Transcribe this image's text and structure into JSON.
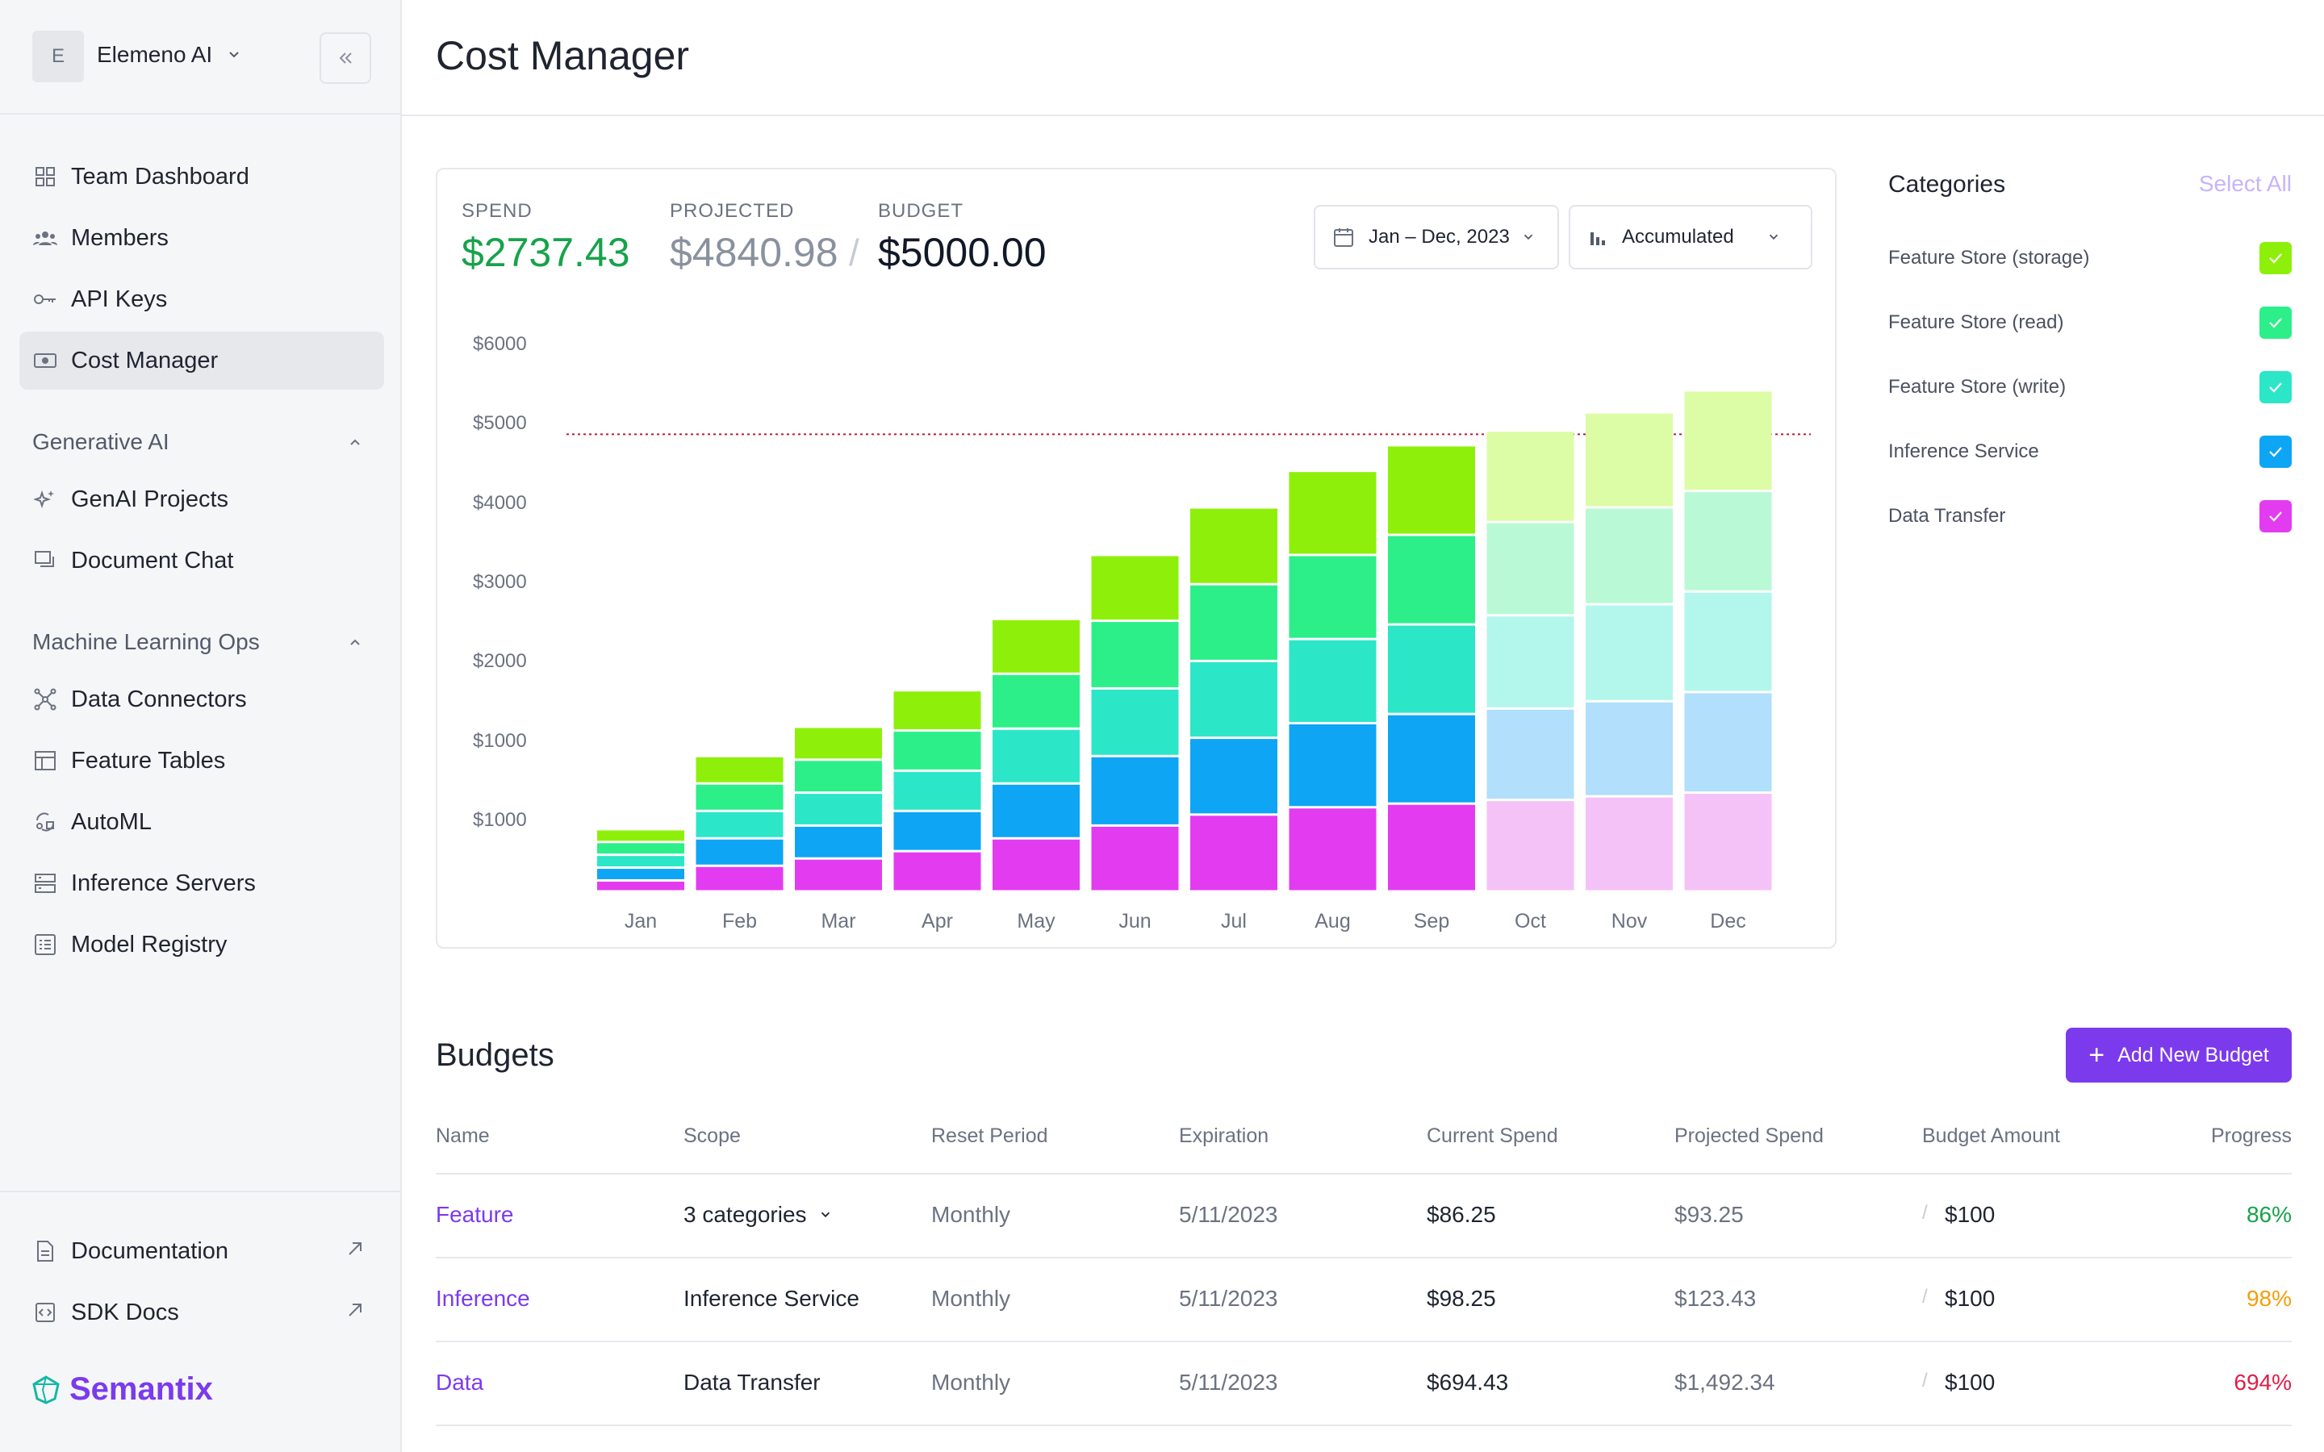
{
  "org": {
    "avatar_letter": "E",
    "name": "Elemeno AI"
  },
  "sidebar": {
    "items": [
      {
        "label": "Team Dashboard",
        "icon": "grid-icon"
      },
      {
        "label": "Members",
        "icon": "users-icon"
      },
      {
        "label": "API Keys",
        "icon": "key-icon"
      },
      {
        "label": "Cost Manager",
        "icon": "cash-icon",
        "active": true
      }
    ],
    "sections": [
      {
        "label": "Generative AI",
        "items": [
          {
            "label": "GenAI Projects",
            "icon": "sparkles-icon"
          },
          {
            "label": "Document Chat",
            "icon": "chat-icon"
          }
        ]
      },
      {
        "label": "Machine Learning Ops",
        "items": [
          {
            "label": "Data Connectors",
            "icon": "hub-icon"
          },
          {
            "label": "Feature Tables",
            "icon": "table-icon"
          },
          {
            "label": "AutoML",
            "icon": "automl-icon"
          },
          {
            "label": "Inference Servers",
            "icon": "server-icon"
          },
          {
            "label": "Model Registry",
            "icon": "registry-icon"
          }
        ]
      }
    ],
    "footer": [
      {
        "label": "Documentation",
        "icon": "document-icon"
      },
      {
        "label": "SDK Docs",
        "icon": "code-icon"
      }
    ],
    "brand": "Semantix"
  },
  "page": {
    "title": "Cost Manager"
  },
  "metrics": {
    "spend_label": "SPEND",
    "spend_value": "$2737.43",
    "projected_label": "PROJECTED",
    "projected_value": "$4840.98",
    "slash": "/",
    "budget_label": "BUDGET",
    "budget_value": "$5000.00"
  },
  "controls": {
    "date_range": "Jan – Dec, 2023",
    "mode": "Accumulated"
  },
  "categories": {
    "title": "Categories",
    "select_all": "Select All",
    "items": [
      {
        "label": "Feature Store (storage)",
        "color": "#8ef00a",
        "checked": true
      },
      {
        "label": "Feature Store (read)",
        "color": "#2cef8a",
        "checked": true
      },
      {
        "label": "Feature Store (write)",
        "color": "#2ce6c8",
        "checked": true
      },
      {
        "label": "Inference Service",
        "color": "#0ea5f5",
        "checked": true
      },
      {
        "label": "Data Transfer",
        "color": "#e33cf0",
        "checked": true
      }
    ]
  },
  "chart_data": {
    "type": "bar",
    "stacked": true,
    "categories": [
      "Jan",
      "Feb",
      "Mar",
      "Apr",
      "May",
      "Jun",
      "Jul",
      "Aug",
      "Sep",
      "Oct",
      "Nov",
      "Dec"
    ],
    "y_tick_labels": [
      "$6000",
      "$5000",
      "$4000",
      "$3000",
      "$2000",
      "$1000",
      "$1000"
    ],
    "ylim": [
      0,
      6000
    ],
    "budget_line": 5000,
    "projected_from": "Oct",
    "series": [
      {
        "name": "Data Transfer",
        "color": "#e33cf0",
        "projected_color": "#f5c2f7",
        "values": [
          120,
          280,
          360,
          440,
          580,
          720,
          840,
          920,
          960,
          1000,
          1040,
          1080
        ]
      },
      {
        "name": "Inference Service",
        "color": "#0ea5f5",
        "projected_color": "#b1dffc",
        "values": [
          140,
          300,
          360,
          440,
          600,
          760,
          840,
          920,
          980,
          1000,
          1040,
          1100
        ]
      },
      {
        "name": "Feature Store (write)",
        "color": "#2ce6c8",
        "projected_color": "#b3f6ec",
        "values": [
          140,
          300,
          360,
          440,
          600,
          740,
          840,
          920,
          980,
          1020,
          1060,
          1100
        ]
      },
      {
        "name": "Feature Store (read)",
        "color": "#2cef8a",
        "projected_color": "#b9f9d6",
        "values": [
          140,
          300,
          360,
          440,
          600,
          740,
          840,
          920,
          980,
          1020,
          1060,
          1100
        ]
      },
      {
        "name": "Feature Store (storage)",
        "color": "#8ef00a",
        "projected_color": "#dcfca5",
        "values": [
          140,
          300,
          360,
          440,
          600,
          720,
          840,
          920,
          980,
          1000,
          1040,
          1100
        ]
      }
    ]
  },
  "budgets": {
    "title": "Budgets",
    "add_label": "Add New Budget",
    "columns": [
      "Name",
      "Scope",
      "Reset Period",
      "Expiration",
      "Current Spend",
      "Projected Spend",
      "Budget Amount",
      "Progress"
    ],
    "rows": [
      {
        "name": "Feature",
        "scope": "3 categories",
        "scope_dropdown": true,
        "reset": "Monthly",
        "expiration": "5/11/2023",
        "current": "$86.25",
        "projected": "$93.25",
        "amount": "$100",
        "progress": "86%",
        "progress_color": "#16a34a"
      },
      {
        "name": "Inference",
        "scope": "Inference Service",
        "scope_dropdown": false,
        "reset": "Monthly",
        "expiration": "5/11/2023",
        "current": "$98.25",
        "projected": "$123.43",
        "amount": "$100",
        "progress": "98%",
        "progress_color": "#f59e0b"
      },
      {
        "name": "Data",
        "scope": "Data Transfer",
        "scope_dropdown": false,
        "reset": "Monthly",
        "expiration": "5/11/2023",
        "current": "$694.43",
        "projected": "$1,492.34",
        "amount": "$100",
        "progress": "694%",
        "progress_color": "#e11d48"
      }
    ]
  }
}
